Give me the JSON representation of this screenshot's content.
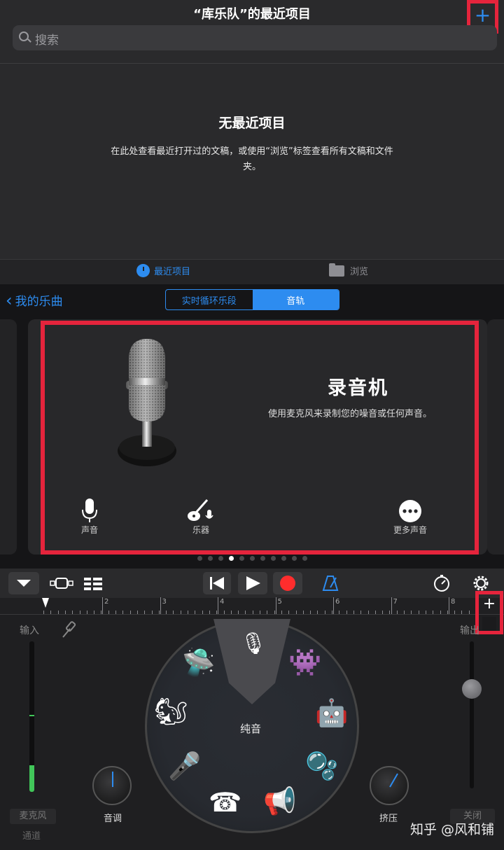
{
  "header": {
    "title": "“库乐队”的最近项目",
    "add_label": "+"
  },
  "search": {
    "placeholder": "搜索"
  },
  "empty": {
    "title": "无最近项目",
    "description": "在此处查看最近打开过的文稿，或使用“浏览”标签查看所有文稿和文件夹。"
  },
  "tabs": {
    "recent": "最近项目",
    "browse": "浏览"
  },
  "nav": {
    "back_label": "我的乐曲"
  },
  "segmented": {
    "live_loops": "实时循环乐段",
    "tracks": "音轨",
    "selected": "音轨"
  },
  "instrument": {
    "title": "录音机",
    "description": "使用麦克风来录制您的噪音或任何声音。",
    "voice_label": "声音",
    "instrument_label": "乐器",
    "more_label": "更多声音"
  },
  "pager": {
    "count": 11,
    "active_index": 3
  },
  "ruler": {
    "marks": [
      "2",
      "3",
      "4",
      "5",
      "6",
      "7",
      "8"
    ],
    "add_label": "+"
  },
  "recorder": {
    "input_label": "输入",
    "output_label": "输出",
    "pitch_label": "音调",
    "compress_label": "挤压",
    "preset_label": "纯音",
    "mic_button": "麦克风",
    "channel_label": "通道",
    "close_button": "关闭"
  },
  "colors": {
    "accent": "#2d8cf0",
    "highlight": "#e5243c",
    "record": "#ff2d2d",
    "meter": "#41c659"
  },
  "watermark": {
    "text": "知乎 @风和铺"
  }
}
